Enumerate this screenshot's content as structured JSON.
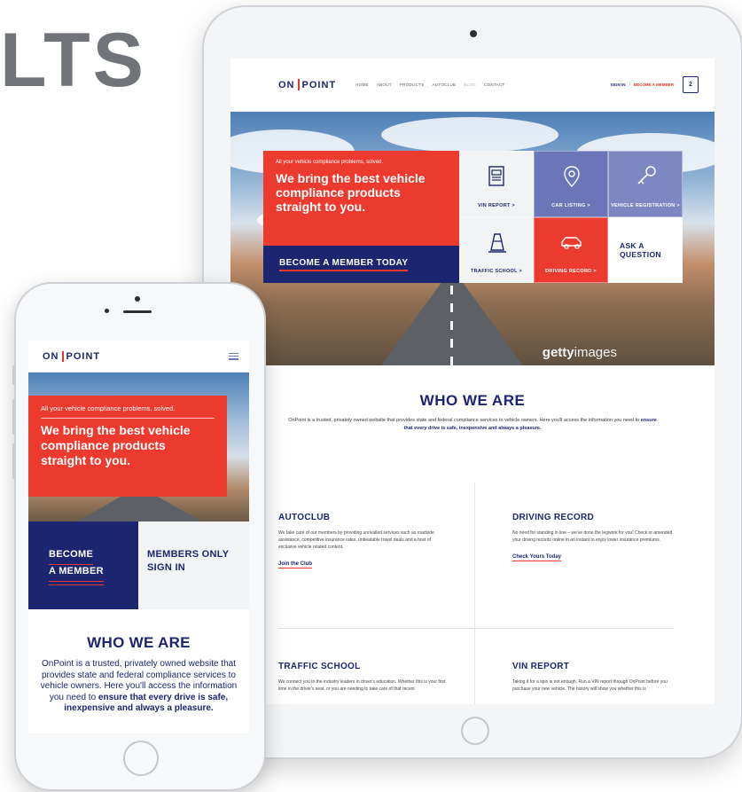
{
  "heading_partial": "LTS",
  "site": {
    "logo_left": "ON",
    "logo_right": "POINT"
  },
  "tablet": {
    "nav": [
      "HOME",
      "ABOUT",
      "PRODUCTS",
      "AUTOCLUB",
      "BLOG",
      "CONTACT"
    ],
    "sign_in": "SIGN IN",
    "separator": "/",
    "become_member_link": "BECOME A MEMBER",
    "cart_count": "2",
    "hero": {
      "tagline": "All your vehicle compliance problems, solved.",
      "headline": "We bring the best vehicle compliance products straight to you.",
      "cta": "BECOME A MEMBER TODAY",
      "credit_bold": "getty",
      "credit_rest": "images"
    },
    "tiles": [
      {
        "label": "VIN REPORT >",
        "icon": "document-icon"
      },
      {
        "label": "CAR LISTING >",
        "icon": "map-pin-icon"
      },
      {
        "label": "VEHICLE REGISTRATION >",
        "icon": "key-icon"
      },
      {
        "label": "TRAFFIC SCHOOL >",
        "icon": "traffic-cone-icon"
      },
      {
        "label": "DRIVING RECORD >",
        "icon": "car-icon"
      },
      {
        "label": "ASK A QUESTION"
      }
    ],
    "who": {
      "title": "WHO WE ARE",
      "text_pre": "OnPoint is a trusted, privately owned website that provides state and federal compliance services to vehicle owners. Here you'll access the information you need to ",
      "text_bold": "ensure that every drive is safe, inexpensive and always a pleasure."
    },
    "cards": [
      {
        "title": "AUTOCLUB",
        "text": "We take care of our members by providing unrivalled services such as roadside assistance, competitive insurance rates, unbeatable travel deals and a host of exclusive vehicle related content.",
        "link": "Join the Club"
      },
      {
        "title": "DRIVING RECORD",
        "text": "No need for standing in line – we've done the legwork for you! Check or amended your driving records online in an instant to enjoy lower insurance premiums.",
        "link": "Check Yours Today"
      },
      {
        "title": "TRAFFIC SCHOOL",
        "text": "We connect you to the industry leaders in driver's education. Whether this is your first time in the driver's seat, or you are needing to take care of that recent"
      },
      {
        "title": "VIN REPORT",
        "text": "Taking it for a spin is not enough. Run a VIN report through OnPoint before you purchase your new vehicle. The history will show you whether this is"
      }
    ]
  },
  "phone": {
    "hero": {
      "tagline": "All your vehicle compliance problems, solved.",
      "headline": "We bring the best vehicle compliance products straight to you."
    },
    "become_line1": "BECOME",
    "become_line2": "A MEMBER",
    "members_line1": "MEMBERS ONLY",
    "members_line2": "SIGN IN",
    "who": {
      "title": "WHO WE ARE",
      "text_pre": "OnPoint is a trusted, privately owned website that provides state and federal compliance services to vehicle owners. Here you'll access the information you need to ",
      "text_bold": "ensure that every drive is safe, inexpensive and always a pleasure."
    }
  },
  "colors": {
    "navy": "#1c2670",
    "red": "#ec3a2f",
    "tile_blue": "#6a76b7",
    "light": "#f2f3f5"
  }
}
